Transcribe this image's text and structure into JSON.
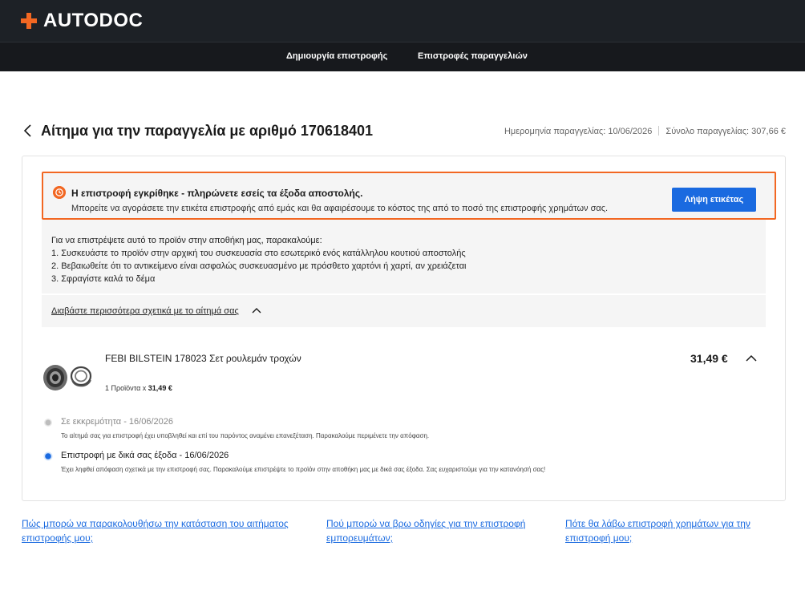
{
  "brand": {
    "logo_text": "AUTODOC",
    "accent": "#f26722"
  },
  "nav": {
    "create_return": "Δημιουργία επιστροφής",
    "order_returns": "Επιστροφές παραγγελιών"
  },
  "header": {
    "title": "Αίτημα για την παραγγελία με αριθμό 170618401",
    "order_date": "Ημερομηνία παραγγελίας: 10/06/2026",
    "order_total": "Σύνολο παραγγελίας: 307,66 €"
  },
  "alert": {
    "title": "Η επιστροφή εγκρίθηκε - πληρώνετε εσείς τα έξοδα αποστολής.",
    "subtitle": "Μπορείτε να αγοράσετε την ετικέτα επιστροφής από εμάς και θα αφαιρέσουμε το κόστος της από το ποσό της επιστροφής χρημάτων σας.",
    "button_label": "Λήψη ετικέτας"
  },
  "instructions": {
    "intro": "Για να επιστρέψετε αυτό το προϊόν στην αποθήκη μας, παρακαλούμε:",
    "steps": [
      "1. Συσκευάστε το προϊόν στην αρχική του συσκευασία στο εσωτερικό ενός κατάλληλου κουτιού αποστολής",
      "2. Βεβαιωθείτε ότι το αντικείμενο είναι ασφαλώς συσκευασμένο με πρόσθετο χαρτόνι ή χαρτί, αν χρειάζεται",
      "3. Σφραγίστε καλά το δέμα"
    ],
    "read_more": "Διαβάστε περισσότερα σχετικά με το αίτημά σας"
  },
  "product": {
    "name": "FEBI BILSTEIN 178023 Σετ ρουλεμάν τροχών",
    "qty_prefix": "1 Προϊόντα x",
    "qty_price": "31,49 €",
    "price": "31,49 €"
  },
  "statuses": [
    {
      "title": "Σε εκκρεμότητα - 16/06/2026",
      "description": "Το αίτημά σας για επιστροφή έχει υποβληθεί και επί του παρόντος αναμένει επανεξέταση. Παρακαλούμε περιμένετε την απόφαση.",
      "color": "#c8c8c8",
      "active": false
    },
    {
      "title": "Επιστροφή με δικά σας έξοδα - 16/06/2026",
      "description": "Έχει ληφθεί απόφαση σχετικά με την επιστροφή σας. Παρακαλούμε επιστρέψτε το προϊόν στην αποθήκη μας με δικά σας έξοδα. Σας ευχαριστούμε για την κατανόησή σας!",
      "color": "#1a6ae0",
      "active": true
    }
  ],
  "faq": [
    "Πώς μπορώ να παρακολουθήσω την κατάσταση του αιτήματος επιστροφής μου;",
    "Πού μπορώ να βρω οδηγίες για την επιστροφή εμπορευμάτων;",
    "Πότε θα λάβω επιστροφή χρημάτων για την επιστροφή μου;"
  ]
}
